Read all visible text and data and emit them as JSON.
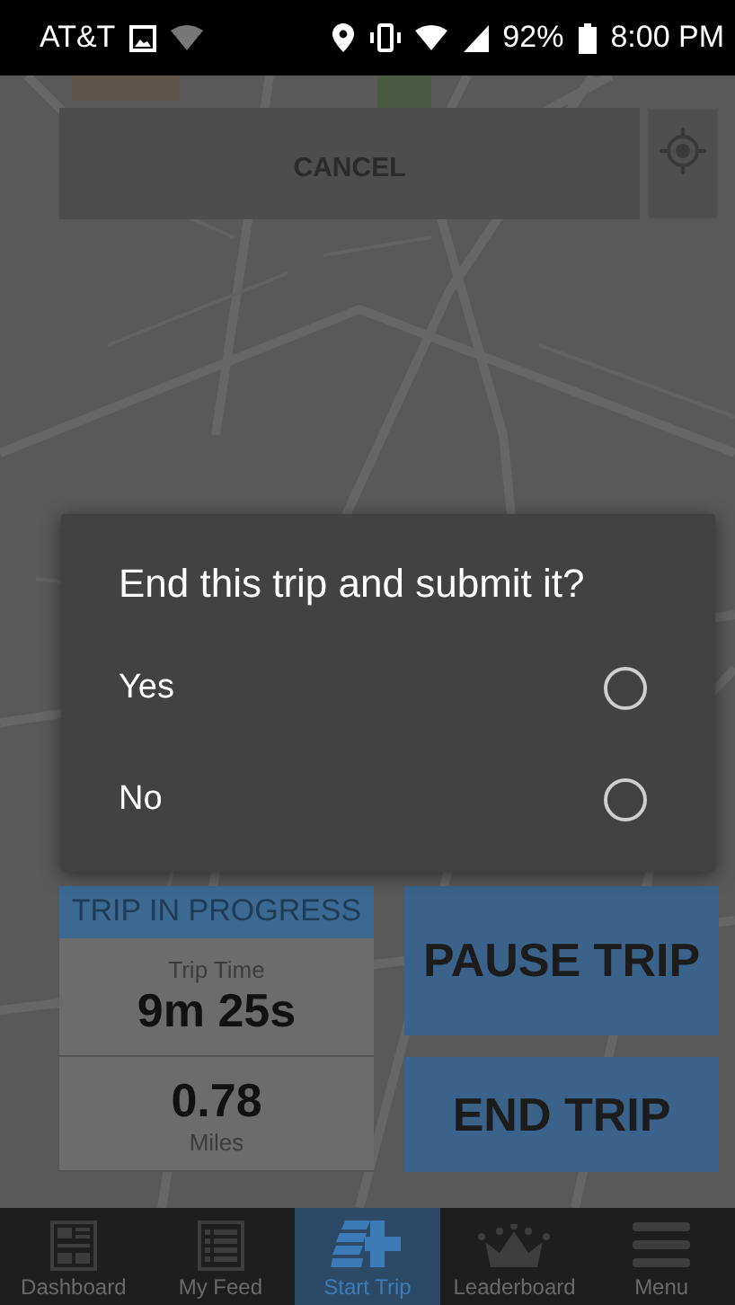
{
  "status_bar": {
    "carrier": "AT&T",
    "battery": "92%",
    "time": "8:00 PM"
  },
  "map": {
    "cancel": "CANCEL"
  },
  "dialog": {
    "title": "End this trip and submit it?",
    "options": [
      {
        "label": "Yes",
        "selected": false
      },
      {
        "label": "No",
        "selected": false
      }
    ]
  },
  "trip": {
    "header": "TRIP IN PROGRESS",
    "time_label": "Trip Time",
    "time": "9m 25s",
    "distance": "0.78",
    "distance_unit": "Miles"
  },
  "actions": [
    {
      "kind": "pause",
      "label": "PAUSE TRIP"
    },
    {
      "kind": "end",
      "label": "END TRIP"
    }
  ],
  "nav": [
    {
      "kind": "dashboard",
      "label": "Dashboard",
      "selected": false
    },
    {
      "kind": "feed",
      "label": "My Feed",
      "selected": false
    },
    {
      "kind": "start",
      "label": "Start Trip",
      "selected": true
    },
    {
      "kind": "leaderboard",
      "label": "Leaderboard",
      "selected": false
    },
    {
      "kind": "menu",
      "label": "Menu",
      "selected": false
    }
  ]
}
